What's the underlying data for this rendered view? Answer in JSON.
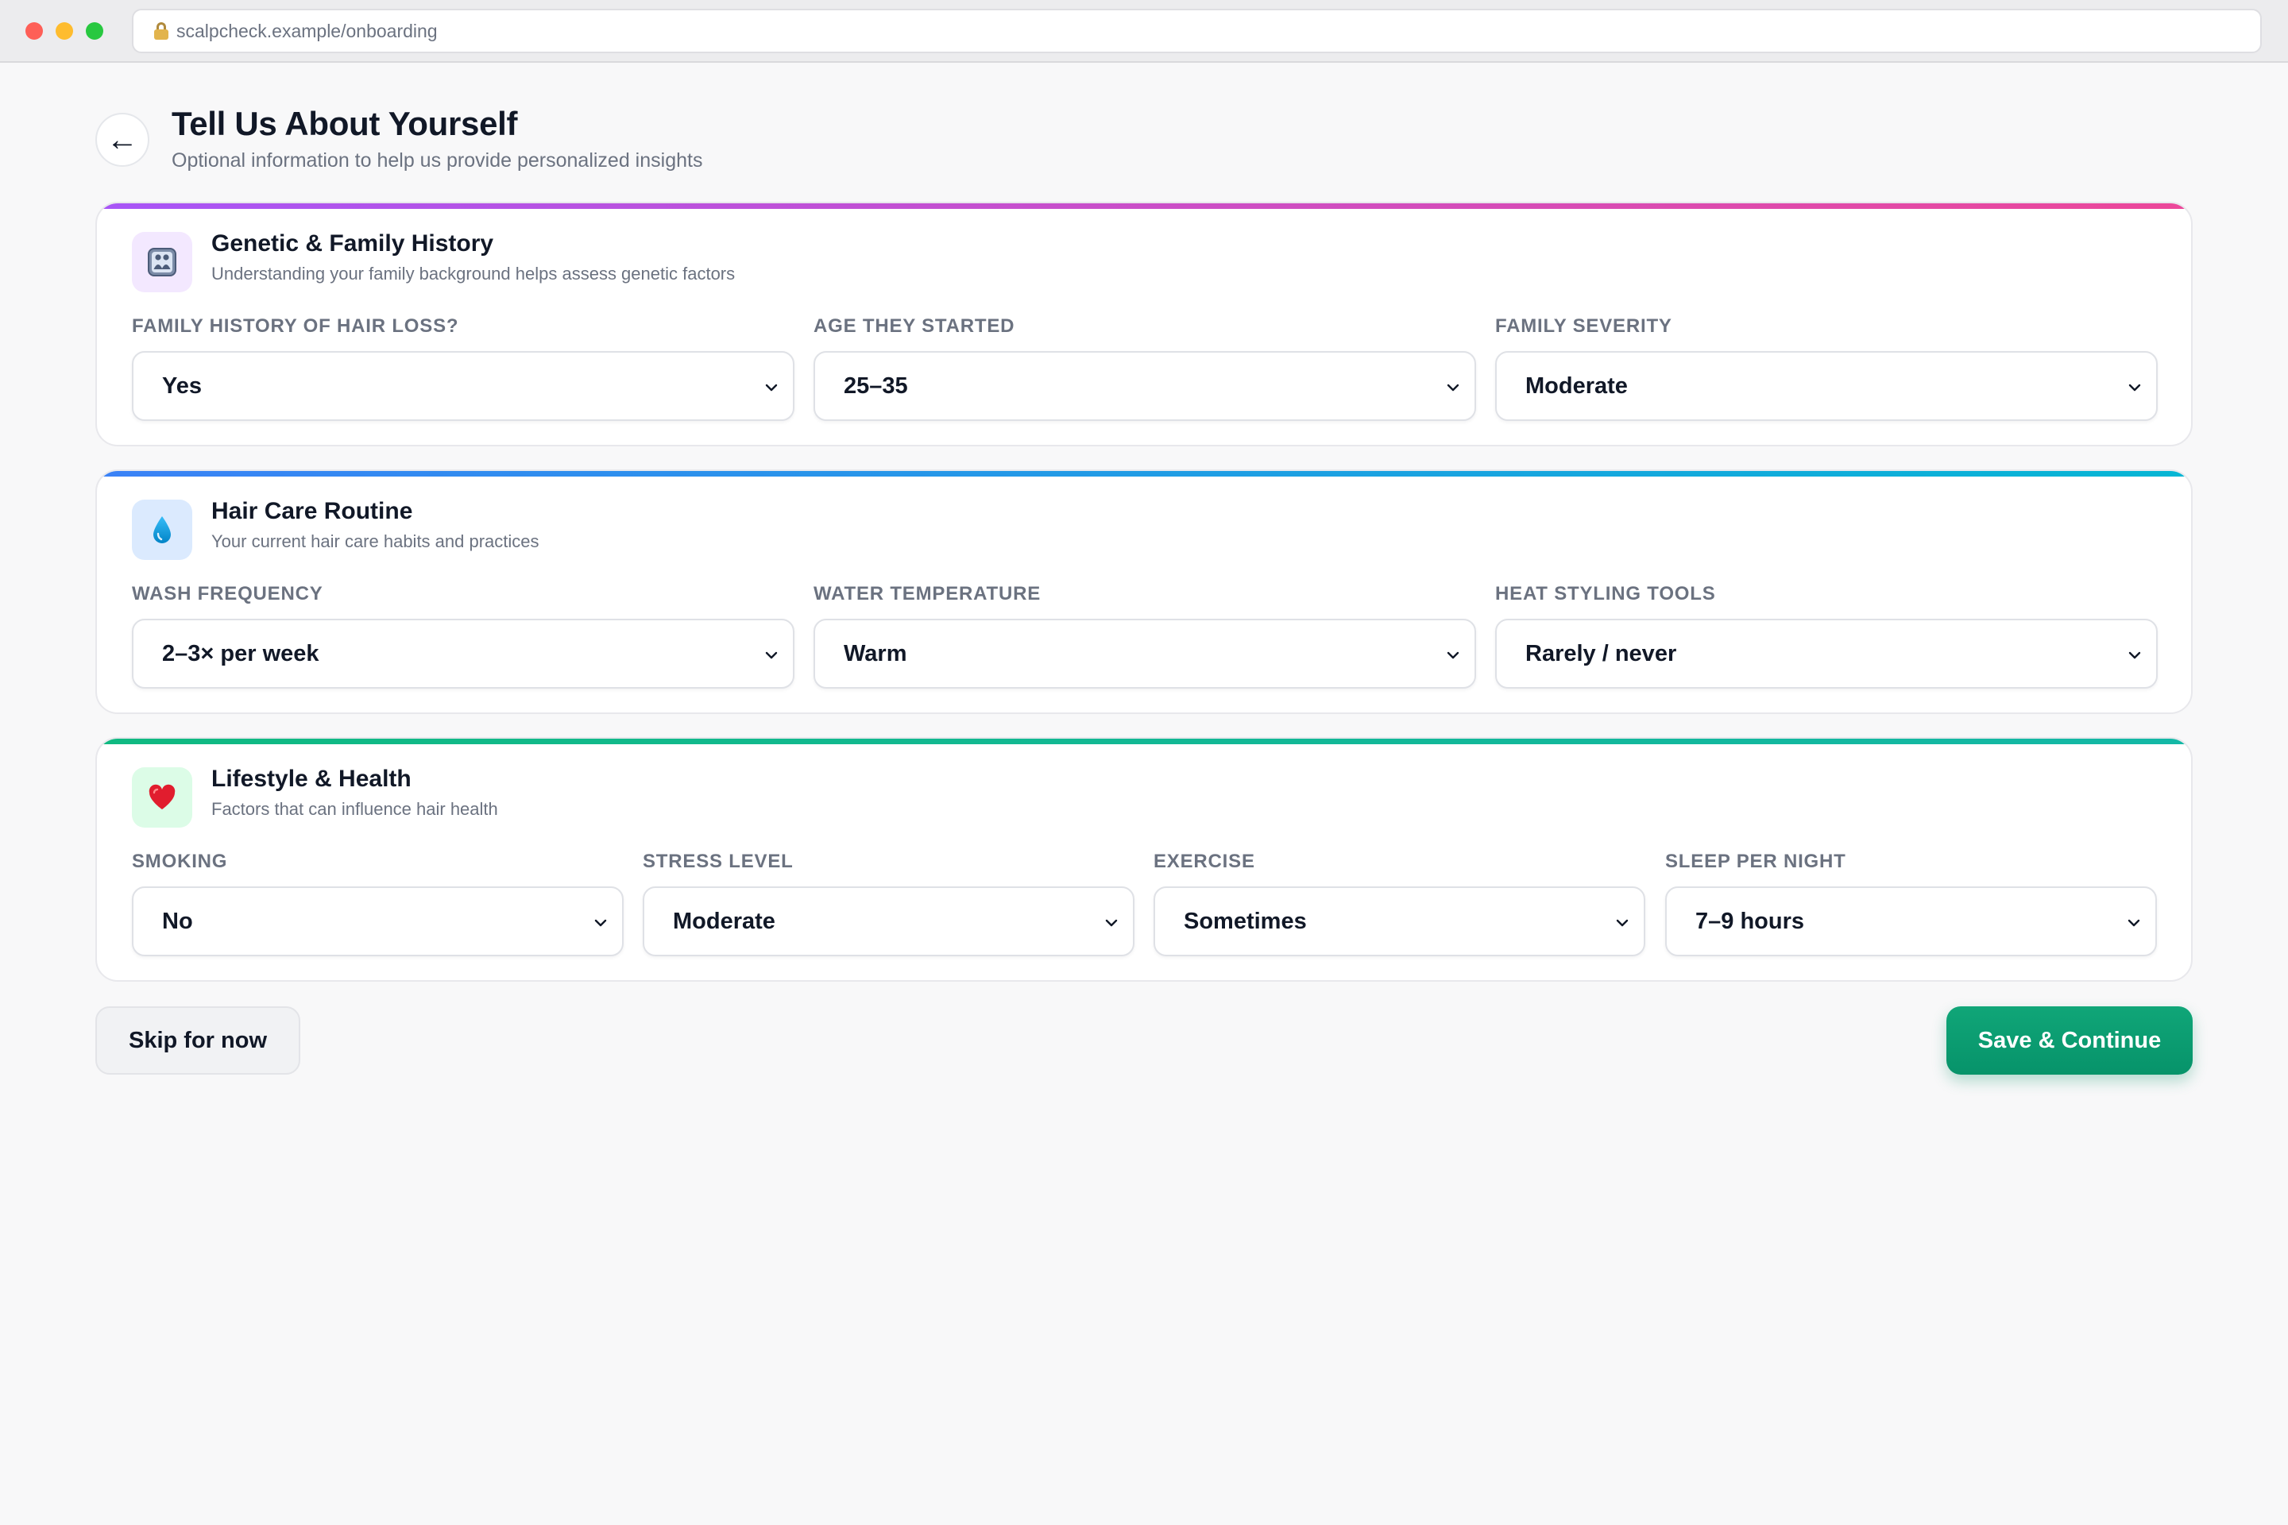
{
  "browser": {
    "url": "scalpcheck.example/onboarding"
  },
  "header": {
    "back_icon": "←",
    "title": "Tell Us About Yourself",
    "subtitle": "Optional information to help us provide personalized insights"
  },
  "sections": [
    {
      "icon": "family-icon",
      "title": "Genetic & Family History",
      "description": "Understanding your family background helps assess genetic factors",
      "fields": [
        {
          "label": "FAMILY HISTORY OF HAIR LOSS?",
          "value": "Yes"
        },
        {
          "label": "AGE THEY STARTED",
          "value": "25–35"
        },
        {
          "label": "FAMILY SEVERITY",
          "value": "Moderate"
        }
      ]
    },
    {
      "icon": "water-drop-icon",
      "title": "Hair Care Routine",
      "description": "Your current hair care habits and practices",
      "fields": [
        {
          "label": "WASH FREQUENCY",
          "value": "2–3× per week"
        },
        {
          "label": "WATER TEMPERATURE",
          "value": "Warm"
        },
        {
          "label": "HEAT STYLING TOOLS",
          "value": "Rarely / never"
        }
      ]
    },
    {
      "icon": "heart-icon",
      "title": "Lifestyle & Health",
      "description": "Factors that can influence hair health",
      "fields": [
        {
          "label": "SMOKING",
          "value": "No"
        },
        {
          "label": "STRESS LEVEL",
          "value": "Moderate"
        },
        {
          "label": "EXERCISE",
          "value": "Sometimes"
        },
        {
          "label": "SLEEP PER NIGHT",
          "value": "7–9 hours"
        }
      ]
    }
  ],
  "actions": {
    "skip_label": "Skip for now",
    "save_label": "Save & Continue"
  },
  "colors": {
    "accent_green": "#10a678",
    "genetic_gradient": [
      "#a855f7",
      "#ec4899"
    ],
    "routine_gradient": [
      "#3b82f6",
      "#06b6d4"
    ],
    "lifestyle_gradient": [
      "#10b981",
      "#14b8a6"
    ]
  }
}
